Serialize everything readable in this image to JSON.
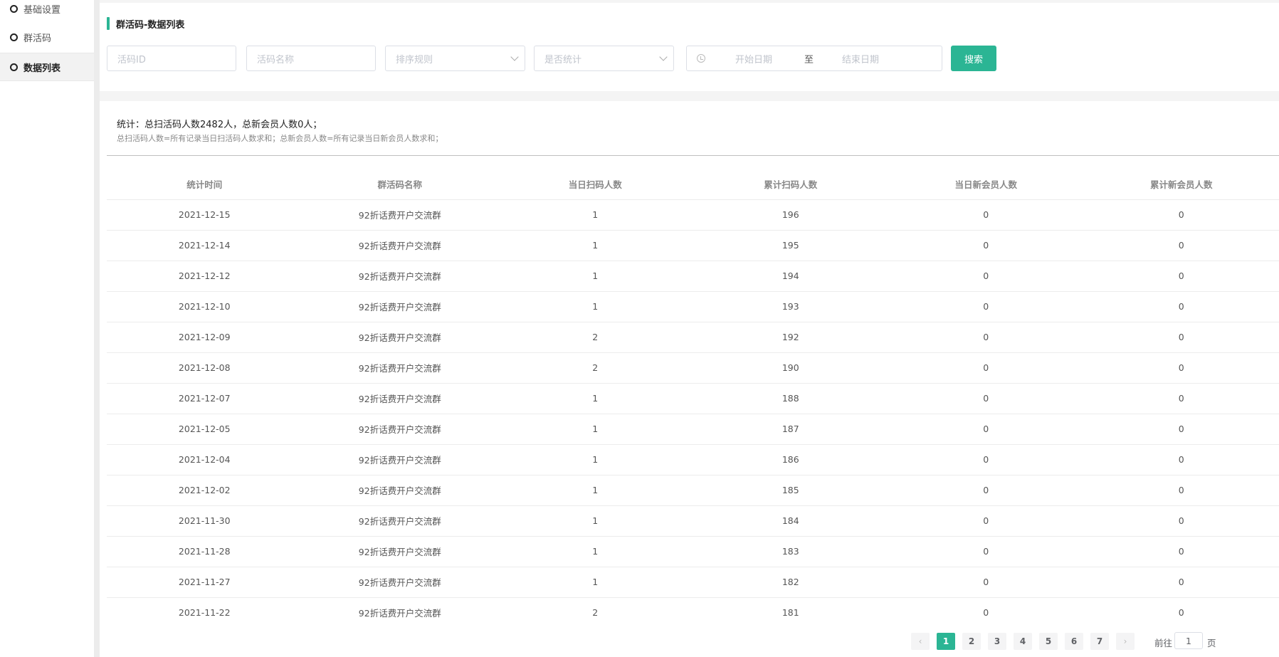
{
  "sidebar": {
    "items": [
      {
        "label": "基础设置"
      },
      {
        "label": "群活码"
      },
      {
        "label": "数据列表"
      }
    ]
  },
  "panel": {
    "title": "群活码-数据列表"
  },
  "filters": {
    "code_id_placeholder": "活码ID",
    "code_name_placeholder": "活码名称",
    "sort_placeholder": "排序规则",
    "stat_placeholder": "是否统计",
    "date_start_placeholder": "开始日期",
    "date_separator": "至",
    "date_end_placeholder": "结束日期",
    "search_label": "搜索"
  },
  "stats": {
    "summary": "统计：总扫活码人数2482人，总新会员人数0人；",
    "note": "总扫活码人数=所有记录当日扫活码人数求和；总新会员人数=所有记录当日新会员人数求和；"
  },
  "table": {
    "headers": [
      "统计时间",
      "群活码名称",
      "当日扫码人数",
      "累计扫码人数",
      "当日新会员人数",
      "累计新会员人数"
    ],
    "rows": [
      [
        "2021-12-15",
        "92折话费开户交流群",
        "1",
        "196",
        "0",
        "0"
      ],
      [
        "2021-12-14",
        "92折话费开户交流群",
        "1",
        "195",
        "0",
        "0"
      ],
      [
        "2021-12-12",
        "92折话费开户交流群",
        "1",
        "194",
        "0",
        "0"
      ],
      [
        "2021-12-10",
        "92折话费开户交流群",
        "1",
        "193",
        "0",
        "0"
      ],
      [
        "2021-12-09",
        "92折话费开户交流群",
        "2",
        "192",
        "0",
        "0"
      ],
      [
        "2021-12-08",
        "92折话费开户交流群",
        "2",
        "190",
        "0",
        "0"
      ],
      [
        "2021-12-07",
        "92折话费开户交流群",
        "1",
        "188",
        "0",
        "0"
      ],
      [
        "2021-12-05",
        "92折话费开户交流群",
        "1",
        "187",
        "0",
        "0"
      ],
      [
        "2021-12-04",
        "92折话费开户交流群",
        "1",
        "186",
        "0",
        "0"
      ],
      [
        "2021-12-02",
        "92折话费开户交流群",
        "1",
        "185",
        "0",
        "0"
      ],
      [
        "2021-11-30",
        "92折话费开户交流群",
        "1",
        "184",
        "0",
        "0"
      ],
      [
        "2021-11-28",
        "92折话费开户交流群",
        "1",
        "183",
        "0",
        "0"
      ],
      [
        "2021-11-27",
        "92折话费开户交流群",
        "1",
        "182",
        "0",
        "0"
      ],
      [
        "2021-11-22",
        "92折话费开户交流群",
        "2",
        "181",
        "0",
        "0"
      ]
    ]
  },
  "pagination": {
    "pages": [
      "1",
      "2",
      "3",
      "4",
      "5",
      "6",
      "7"
    ],
    "current": "1",
    "prev_icon": "‹",
    "next_icon": "›",
    "goto_prefix": "前往",
    "goto_value": "1",
    "goto_suffix": "页"
  },
  "colors": {
    "accent": "#2bb594"
  }
}
